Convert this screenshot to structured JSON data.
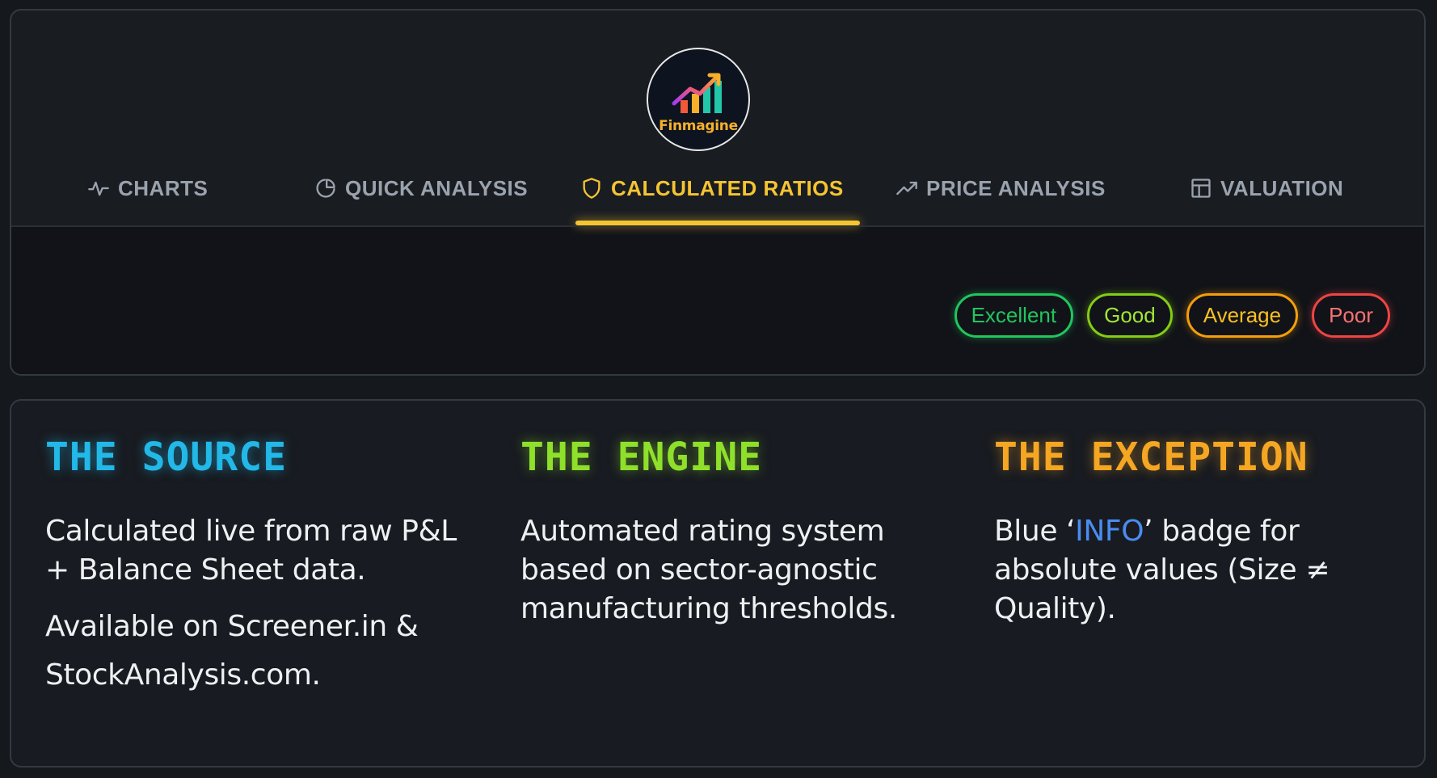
{
  "brand": {
    "name": "Finmagine"
  },
  "tabs": [
    {
      "label": "CHARTS",
      "icon": "activity-icon",
      "active": false
    },
    {
      "label": "QUICK ANALYSIS",
      "icon": "pie-chart-icon",
      "active": false
    },
    {
      "label": "CALCULATED RATIOS",
      "icon": "shield-icon",
      "active": true
    },
    {
      "label": "PRICE ANALYSIS",
      "icon": "trending-up-icon",
      "active": false
    },
    {
      "label": "VALUATION",
      "icon": "table-icon",
      "active": false
    }
  ],
  "legend": [
    {
      "label": "Excellent",
      "color": "#22c55e"
    },
    {
      "label": "Good",
      "color": "#84cc16"
    },
    {
      "label": "Average",
      "color": "#f59e0b"
    },
    {
      "label": "Poor",
      "color": "#ef4444"
    }
  ],
  "info": {
    "source": {
      "title": "THE SOURCE",
      "color": "#22b8e8",
      "line1": "Calculated live from raw P&L + Balance Sheet data.",
      "line2": "Available on Screener.in & StockAnalysis.com."
    },
    "engine": {
      "title": "THE ENGINE",
      "color": "#8ee02a",
      "line1": "Automated rating system based on sector-agnostic manufacturing thresholds."
    },
    "exception": {
      "title": "THE EXCEPTION",
      "color": "#f5a623",
      "prefix": "Blue ‘",
      "highlight": "INFO",
      "suffix": "’ badge for absolute values (Size ≠ Quality)."
    }
  },
  "colors": {
    "accent": "#f5c431",
    "background": "#15181d",
    "info_blue": "#4a8cf0"
  }
}
